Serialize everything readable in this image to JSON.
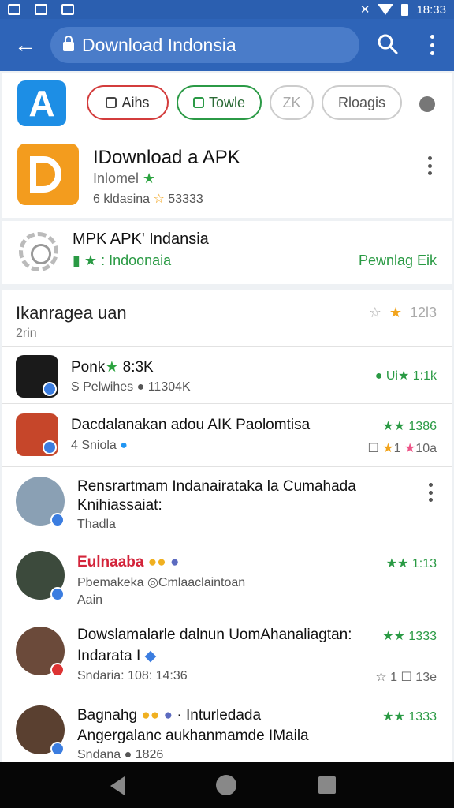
{
  "status_bar": {
    "time": "18:33"
  },
  "app_bar": {
    "url_text": "Download Indonsia"
  },
  "chips": [
    "Aihs",
    "Towle",
    "ZK",
    "Rloagis"
  ],
  "featured_app": {
    "title": "IDownload a APK",
    "subtitle": "Inlomel",
    "meta": "6 kldasina",
    "meta_count": "53333"
  },
  "promo": {
    "title": "MPK APK' Indansia",
    "tag": "Indoonaia",
    "right_text": "Pewnlag Eik"
  },
  "list": {
    "header_title": "Ikanragea uan",
    "header_sub": "2rin",
    "header_count": "12l3",
    "rows": [
      {
        "title": "Ponk",
        "title_extra": "8:3K",
        "sub": "S Pelwihes",
        "sub_extra": "11304K",
        "right": "Ui",
        "right_count": "1:1k"
      },
      {
        "title": "Dacdalanakan adou AIK Paolomtisa",
        "sub": "4 Sniola",
        "right_count": "1386",
        "right2": "1",
        "right2_count": "10a"
      },
      {
        "title": "Rensrartmam Indanairataka la Cumahada",
        "title2": "Knihiassaiat:",
        "sub": "Thadla"
      },
      {
        "title": "Eulnaaba",
        "sub": "Pbemakeka",
        "sub_extra": "Cmlaaclaintoan",
        "sub2": "Aain",
        "right_count": "1:13"
      },
      {
        "title": "Dowslamalarle dalnun UomAhanaliagtan:",
        "title2": "Indarata I",
        "sub": "Sndaria: 108: 14:36",
        "right_count": "1333",
        "right2": "1",
        "right2_count": "13e"
      },
      {
        "title": "Bagnahg",
        "title_extra": "Inturledada",
        "title2": "Angergalanc aukhanmamde IMaila",
        "sub": "Sndana",
        "sub_extra": "1826",
        "right_count": "1333"
      }
    ]
  },
  "colors": {
    "appbar": "#2e64b8",
    "accent_green": "#2a9a44",
    "store_blue": "#1d8ee5",
    "logo_orange": "#f39c1e"
  },
  "icons": [
    "back-arrow-icon",
    "lock-icon",
    "search-icon",
    "more-vert-icon",
    "star-icon",
    "verified-icon",
    "gear-icon"
  ]
}
